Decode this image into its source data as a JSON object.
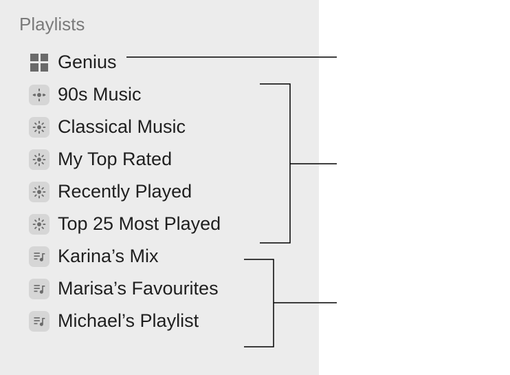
{
  "sidebar": {
    "section_label": "Playlists",
    "items": [
      {
        "type": "genius",
        "label": "Genius",
        "icon": "genius-grid-icon"
      },
      {
        "type": "smart",
        "label": "90s Music",
        "icon": "smart-playlist-icon"
      },
      {
        "type": "smart",
        "label": "Classical Music",
        "icon": "smart-playlist-icon"
      },
      {
        "type": "smart",
        "label": "My Top Rated",
        "icon": "smart-playlist-icon"
      },
      {
        "type": "smart",
        "label": "Recently Played",
        "icon": "smart-playlist-icon"
      },
      {
        "type": "smart",
        "label": "Top 25 Most Played",
        "icon": "smart-playlist-icon"
      },
      {
        "type": "plain",
        "label": "Karina’s Mix",
        "icon": "playlist-icon"
      },
      {
        "type": "plain",
        "label": "Marisa’s Favourites",
        "icon": "playlist-icon"
      },
      {
        "type": "plain",
        "label": "Michael’s Playlist",
        "icon": "playlist-icon"
      }
    ]
  }
}
